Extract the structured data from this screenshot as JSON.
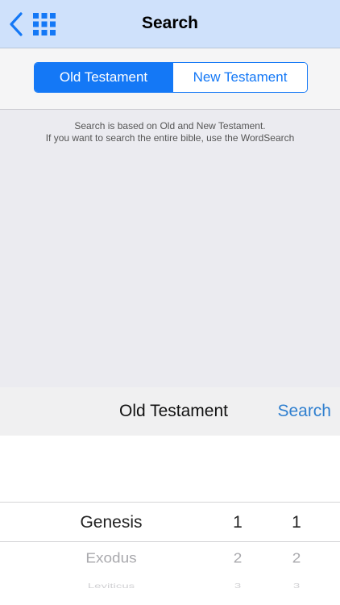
{
  "navbar": {
    "title": "Search",
    "back_icon": "chevron-left-icon",
    "menu_icon": "grid-icon",
    "accent_color": "#1478f6"
  },
  "segments": {
    "old_label": "Old Testament",
    "new_label": "New Testament",
    "selected": "Old Testament"
  },
  "info": {
    "line1": "Search is based on Old and New Testament.",
    "line2": "If you want to search the entire bible, use the WordSearch"
  },
  "toolbar": {
    "title": "Old Testament",
    "action_label": "Search"
  },
  "picker": {
    "book_column": [
      "Genesis",
      "Exodus",
      "Leviticus"
    ],
    "chapter_column": [
      "1",
      "2",
      "3"
    ],
    "verse_column": [
      "1",
      "2",
      "3"
    ]
  }
}
